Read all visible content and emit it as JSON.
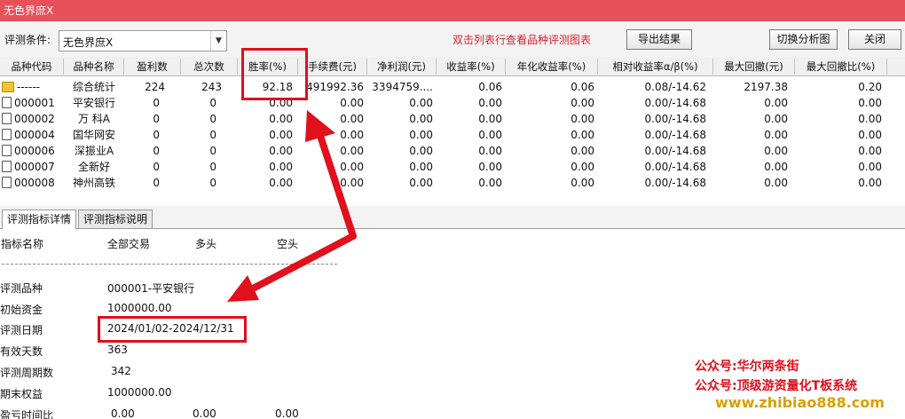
{
  "window": {
    "title": "无色界庶X"
  },
  "toolbar": {
    "condition_label": "评测条件:",
    "condition_value": "无色界庶X",
    "hint": "双击列表行查看品种评测图表",
    "export_label": "导出结果",
    "switch_label": "切换分析图",
    "close_label": "关闭"
  },
  "table": {
    "headers": [
      "品种代码",
      "品种名称",
      "盈利数",
      "总次数",
      "胜率(%)",
      "手续费(元)",
      "净利润(元)",
      "收益率(%)",
      "年化收益率(%)",
      "相对收益率α/β(%)",
      "最大回撤(元)",
      "最大回撤比(%)"
    ],
    "rows": [
      {
        "code": "------",
        "name": "综合统计",
        "win": "224",
        "total": "243",
        "rate": "92.18",
        "fee": "491992.36",
        "profit": "3394759....",
        "ret": "0.06",
        "annual": "0.06",
        "alpha": "0.08/-14.62",
        "maxdd": "2197.38",
        "maxddr": "0.20"
      },
      {
        "code": "000001",
        "name": "平安银行",
        "win": "0",
        "total": "0",
        "rate": "0.00",
        "fee": "0.00",
        "profit": "0.00",
        "ret": "0.00",
        "annual": "0.00",
        "alpha": "0.00/-14.68",
        "maxdd": "0.00",
        "maxddr": "0.00"
      },
      {
        "code": "000002",
        "name": "万 科A",
        "win": "0",
        "total": "0",
        "rate": "0.00",
        "fee": "0.00",
        "profit": "0.00",
        "ret": "0.00",
        "annual": "0.00",
        "alpha": "0.00/-14.68",
        "maxdd": "0.00",
        "maxddr": "0.00"
      },
      {
        "code": "000004",
        "name": "国华网安",
        "win": "0",
        "total": "0",
        "rate": "0.00",
        "fee": "0.00",
        "profit": "0.00",
        "ret": "0.00",
        "annual": "0.00",
        "alpha": "0.00/-14.68",
        "maxdd": "0.00",
        "maxddr": "0.00"
      },
      {
        "code": "000006",
        "name": "深振业A",
        "win": "0",
        "total": "0",
        "rate": "0.00",
        "fee": "0.00",
        "profit": "0.00",
        "ret": "0.00",
        "annual": "0.00",
        "alpha": "0.00/-14.68",
        "maxdd": "0.00",
        "maxddr": "0.00"
      },
      {
        "code": "000007",
        "name": "全新好",
        "win": "0",
        "total": "0",
        "rate": "0.00",
        "fee": "0.00",
        "profit": "0.00",
        "ret": "0.00",
        "annual": "0.00",
        "alpha": "0.00/-14.68",
        "maxdd": "0.00",
        "maxddr": "0.00"
      },
      {
        "code": "000008",
        "name": "神州高铁",
        "win": "0",
        "total": "0",
        "rate": "0.00",
        "fee": "0.00",
        "profit": "0.00",
        "ret": "0.00",
        "annual": "0.00",
        "alpha": "0.00/-14.68",
        "maxdd": "0.00",
        "maxddr": "0.00"
      }
    ]
  },
  "tabs": [
    "评测指标详情",
    "评测指标说明"
  ],
  "detail": {
    "col_headers": [
      "指标名称",
      "全部交易",
      "多头",
      "空头"
    ],
    "rows": [
      {
        "label": "评测品种",
        "value": "000001-平安银行"
      },
      {
        "label": "初始资金",
        "value": "1000000.00"
      },
      {
        "label": "评测日期",
        "value": "2024/01/02-2024/12/31"
      },
      {
        "label": "有效天数",
        "value": "363"
      },
      {
        "label": "评测周期数",
        "value": "342"
      },
      {
        "label": "期末权益",
        "value": "1000000.00"
      }
    ],
    "last_row": {
      "label": "盈亏时间比",
      "all": "0.00",
      "long": "0.00",
      "short": "0.00"
    }
  },
  "watermark": {
    "line1": "公众号:华尔两条街",
    "line2": "公众号:顶级游资量化T板系统",
    "url": "www.zhibiao888.com"
  }
}
